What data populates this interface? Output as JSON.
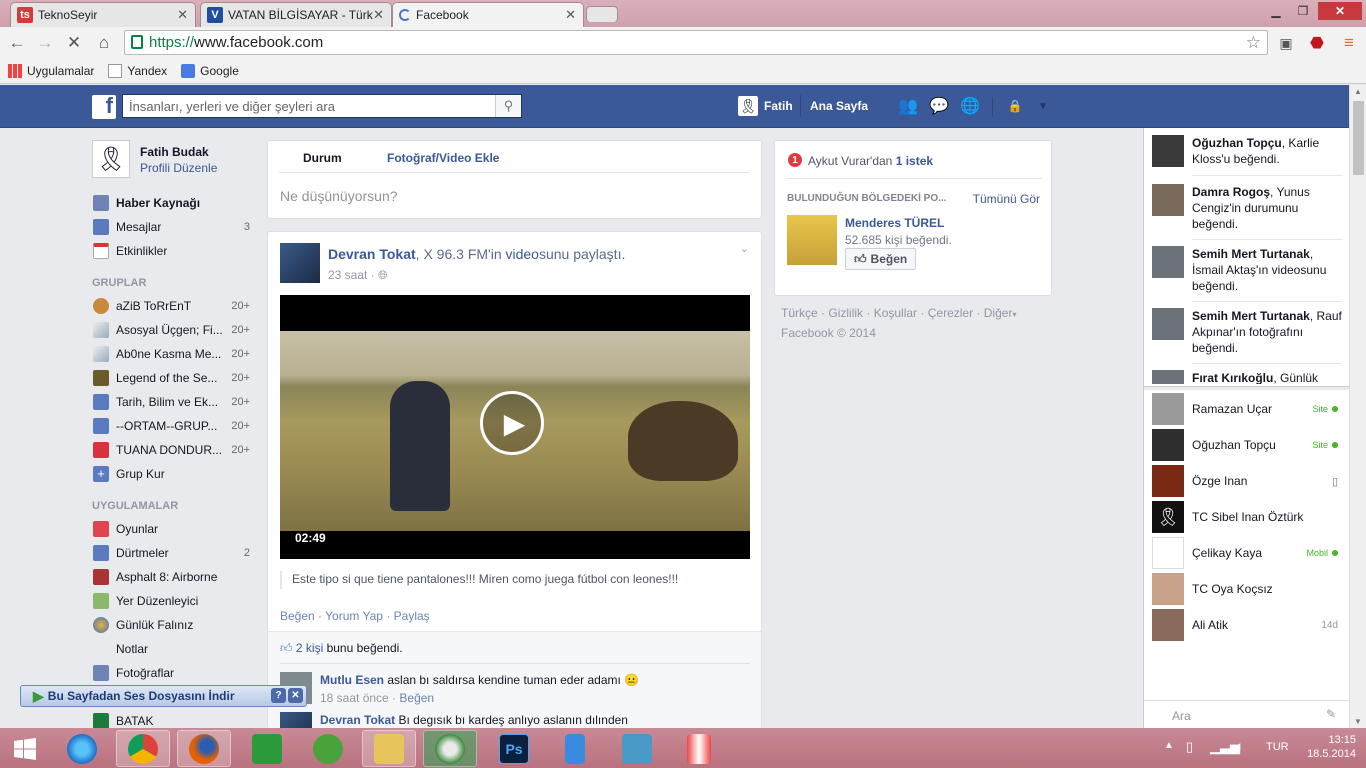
{
  "browser": {
    "tabs": [
      {
        "label": "TeknoSeyir",
        "favicon": "ts-icon"
      },
      {
        "label": "VATAN BİLGİSAYAR - Türk",
        "favicon": "vatan-icon"
      },
      {
        "label": "Facebook",
        "favicon": "loading-icon"
      }
    ],
    "url_scheme": "https://",
    "url_rest": "www.facebook.com",
    "bookmarks": [
      "Uygulamalar",
      "Yandex",
      "Google"
    ]
  },
  "fb": {
    "search_placeholder": "İnsanları, yerleri ve diğer şeyleri ara",
    "user_short": "Fatih",
    "home": "Ana Sayfa"
  },
  "leftnav": {
    "profile_name": "Fatih Budak",
    "profile_edit": "Profili Düzenle",
    "items": [
      {
        "label": "Haber Kaynağı",
        "count": ""
      },
      {
        "label": "Mesajlar",
        "count": "3"
      },
      {
        "label": "Etkinlikler",
        "count": ""
      }
    ],
    "groups_head": "GRUPLAR",
    "groups": [
      {
        "label": "aZiB ToRrEnT",
        "count": "20+"
      },
      {
        "label": "Asosyal Üçgen; Fi...",
        "count": "20+"
      },
      {
        "label": "Ab0ne Kasma Me...",
        "count": "20+"
      },
      {
        "label": "Legend of the Se...",
        "count": "20+"
      },
      {
        "label": "Tarih, Bilim ve Ek...",
        "count": "20+"
      },
      {
        "label": "--ORTAM--GRUP...",
        "count": "20+"
      },
      {
        "label": "TUANA DONDUR...",
        "count": "20+"
      },
      {
        "label": "Grup Kur",
        "count": ""
      }
    ],
    "apps_head": "UYGULAMALAR",
    "apps": [
      {
        "label": "Oyunlar",
        "count": ""
      },
      {
        "label": "Dürtmeler",
        "count": "2"
      },
      {
        "label": "Asphalt 8:  Airborne",
        "count": ""
      },
      {
        "label": "Yer Düzenleyici",
        "count": ""
      },
      {
        "label": "Günlük Falınız",
        "count": ""
      },
      {
        "label": "Notlar",
        "count": ""
      },
      {
        "label": "Fotoğraflar",
        "count": ""
      },
      {
        "label": "BATAK",
        "count": ""
      }
    ]
  },
  "composer": {
    "tab_status": "Durum",
    "tab_photo": "Fotoğraf/Video Ekle",
    "placeholder": "Ne düşünüyorsun?"
  },
  "post": {
    "author": "Devran Tokat",
    "rest1": ", X 96.3 FM",
    "rest2": "'in ",
    "video_word": "video",
    "rest3": "sunu paylaştı.",
    "time": "23 saat ·",
    "duration": "02:49",
    "caption": "Este tipo si que tiene pantalones!!! Miren como juega fútbol con leones!!!",
    "like": "Beğen",
    "comment": "Yorum Yap",
    "share": "Paylaş",
    "likes_prefix": "2 kişi",
    "likes_suffix": " bunu beğendi.",
    "comments": [
      {
        "author": "Mutlu Esen",
        "text": "aslan bı saldırsa kendine tuman eder adamı 😐",
        "time": "18 saat önce",
        "like": "Beğen"
      },
      {
        "author": "Devran Tokat",
        "text": "Bı degısık bı kardeş anlıyo aslanın dılınden",
        "time": "",
        "like": ""
      }
    ]
  },
  "rightcol": {
    "request_count": "1",
    "request_text": "Aykut Vurar'dan",
    "request_link": "1 istek",
    "nearby_head": "BULUNDUĞUN BÖLGEDEKİ PO...",
    "see_all": "Tümünü Gör",
    "page_name": "Menderes TÜREL",
    "page_likes": "52.685 kişi beğendi.",
    "like_button": "Beğen",
    "footer_links": [
      "Türkçe",
      "Gizlilik",
      "Koşullar",
      "Çerezler",
      "Diğer"
    ],
    "copyright": "Facebook © 2014"
  },
  "ticker": [
    {
      "name": "Oğuzhan Topçu",
      "text": ", Karlie Kloss'u beğendi."
    },
    {
      "name": "Damra Rogoş",
      "text": ", Yunus Cengiz'in durumunu beğendi."
    },
    {
      "name": "Semih Mert Turtanak",
      "text": ", İsmail Aktaş'ın videosunu beğendi."
    },
    {
      "name": "Semih Mert Turtanak",
      "text": ", Rauf Akpınar'ın fotoğrafını beğendi."
    },
    {
      "name": "Fırat Kırıkoğlu",
      "text": ", Günlük"
    }
  ],
  "friends": [
    {
      "name": "Ramazan Uçar",
      "status": "Site"
    },
    {
      "name": "Oğuzhan Topçu",
      "status": "Site"
    },
    {
      "name": "Özge Inan",
      "status": ""
    },
    {
      "name": "TC Sibel Inan Öztürk",
      "status": ""
    },
    {
      "name": "Çelikay Kaya",
      "status": "Mobil"
    },
    {
      "name": "TC Oya Koçsız",
      "status": ""
    },
    {
      "name": "Ali Atik",
      "status": "14d"
    }
  ],
  "chat_search": "Ara",
  "download_bar": "Bu Sayfadan Ses Dosyasını İndir",
  "tray": {
    "lang": "TUR",
    "time": "13:15",
    "date": "18.5.2014"
  },
  "colors": {
    "fb_blue": "#3b5998",
    "online_green": "#42b72a"
  }
}
